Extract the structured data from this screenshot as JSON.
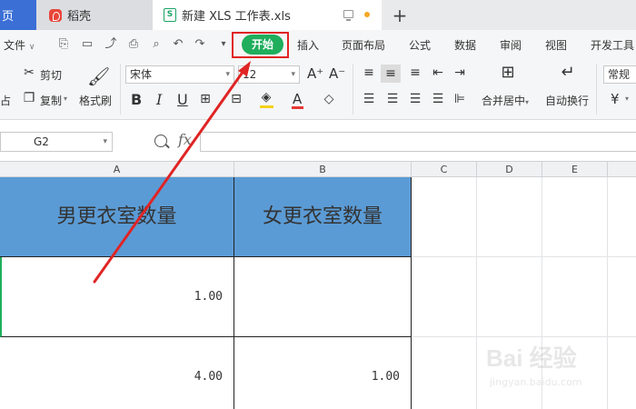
{
  "tabs": {
    "home": "页",
    "daoke": "稻壳",
    "xls": "新建 XLS 工作表.xls",
    "xls_icon_letter": "S",
    "plus": "+"
  },
  "menu": {
    "file": "文件",
    "file_arrow": "∨",
    "start": "开始",
    "insert": "插入",
    "page_layout": "页面布局",
    "formula": "公式",
    "data": "数据",
    "review": "审阅",
    "view": "视图",
    "developer": "开发工具"
  },
  "toolbar": {
    "paste_fragment": "占",
    "cut": "剪切",
    "copy": "复制",
    "format_painter": "格式刷",
    "font_name": "宋体",
    "font_size": "12",
    "bold": "B",
    "italic": "I",
    "underline": "U",
    "font_color_letter": "A",
    "grow_font": "A⁺",
    "shrink_font": "A⁻",
    "merge_center": "合并居中",
    "merge_arrow": "▾",
    "wrap_text": "自动换行",
    "number_format": "常规",
    "currency": "¥"
  },
  "formula_bar": {
    "cell_ref": "G2",
    "fx": "fx",
    "value": ""
  },
  "columns": [
    "A",
    "B",
    "C",
    "D",
    "E"
  ],
  "sheet": {
    "header_a": "男更衣室数量",
    "header_b": "女更衣室数量",
    "rows": [
      {
        "a": "1.00",
        "b": ""
      },
      {
        "a": "4.00",
        "b": "1.00"
      }
    ]
  },
  "watermark": {
    "logo": "Bai 经验",
    "url": "jingyan.baidu.com"
  },
  "colors": {
    "start_button": "#1fae5c",
    "header_fill": "#5b9bd5",
    "highlight": "#e02424",
    "home_tab": "#3b6fd6"
  }
}
